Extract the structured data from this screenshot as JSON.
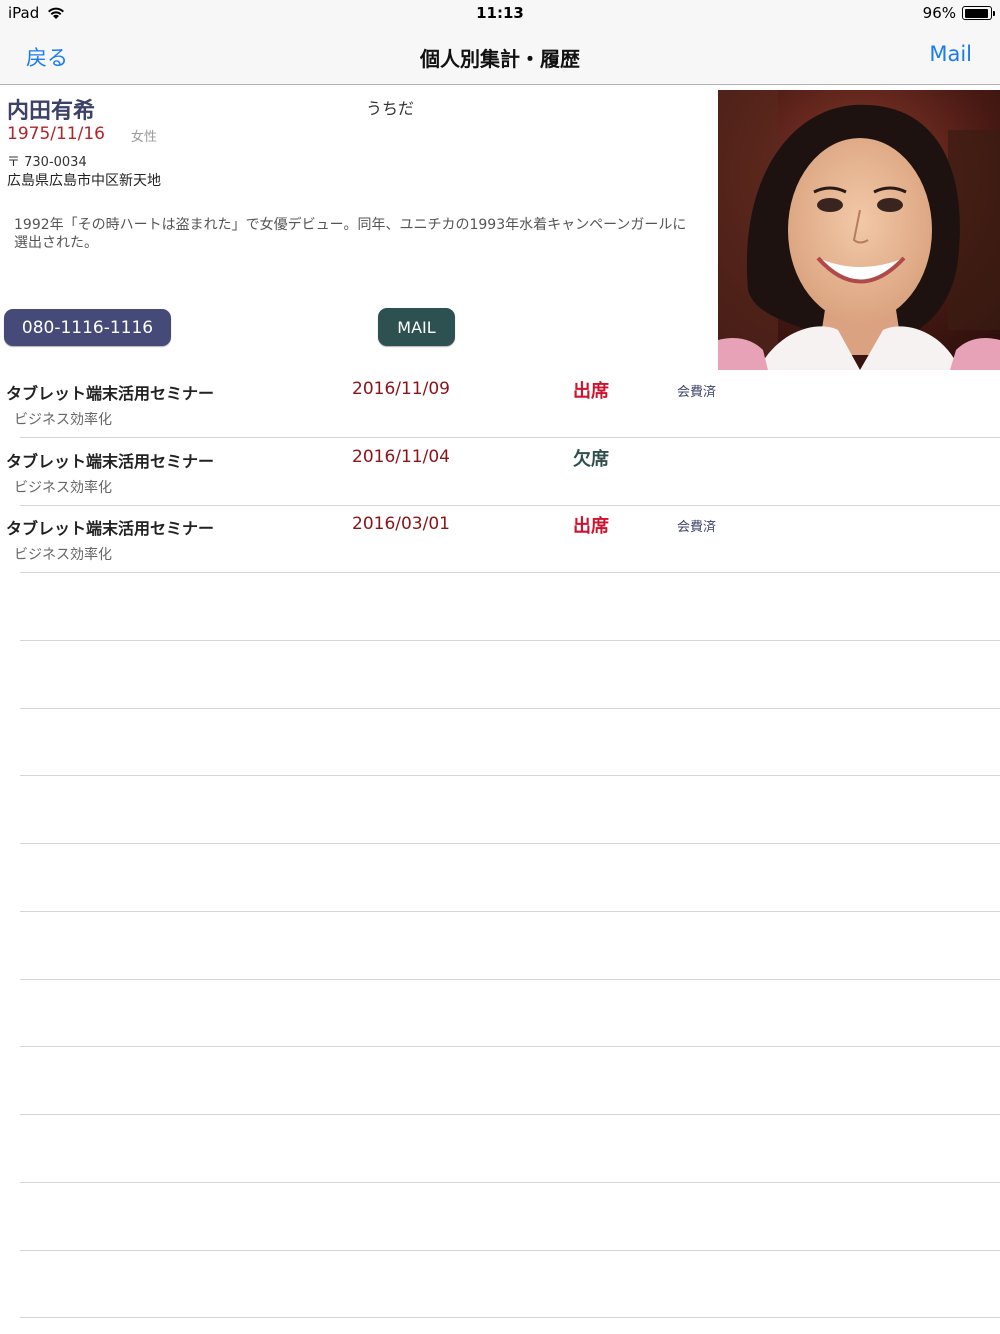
{
  "status_bar": {
    "device": "iPad",
    "time": "11:13",
    "battery": "96%",
    "battery_level": 0.96
  },
  "nav": {
    "back_label": "戻る",
    "title": "個人別集計・履歴",
    "mail_label": "Mail"
  },
  "profile": {
    "name": "内田有希",
    "kana": "うちだ",
    "birthday": "1975/11/16",
    "gender": "女性",
    "postal": "〒 730-0034",
    "address": "広島県広島市中区新天地",
    "bio": "1992年「その時ハートは盗まれた」で女優デビュー。同年、ユニチカの1993年水着キャンペーンガールに選出された。",
    "phone_button": "080-1116-1116",
    "mail_button": "MAIL"
  },
  "history": [
    {
      "title": "タブレット端末活用セミナー",
      "category": "ビジネス効率化",
      "date": "2016/11/09",
      "status": "出席",
      "status_color": "#d0122e",
      "fee": "会費済"
    },
    {
      "title": "タブレット端末活用セミナー",
      "category": "ビジネス効率化",
      "date": "2016/11/04",
      "status": "欠席",
      "status_color": "#2f4f4f",
      "fee": ""
    },
    {
      "title": "タブレット端末活用セミナー",
      "category": "ビジネス効率化",
      "date": "2016/03/01",
      "status": "出席",
      "status_color": "#d0122e",
      "fee": "会費済"
    }
  ],
  "colors": {
    "accent": "#1a7cf5",
    "name": "#3d4168",
    "birthday": "#b3232b",
    "phone_button": "#454a78",
    "mail_button": "#2d5151"
  }
}
